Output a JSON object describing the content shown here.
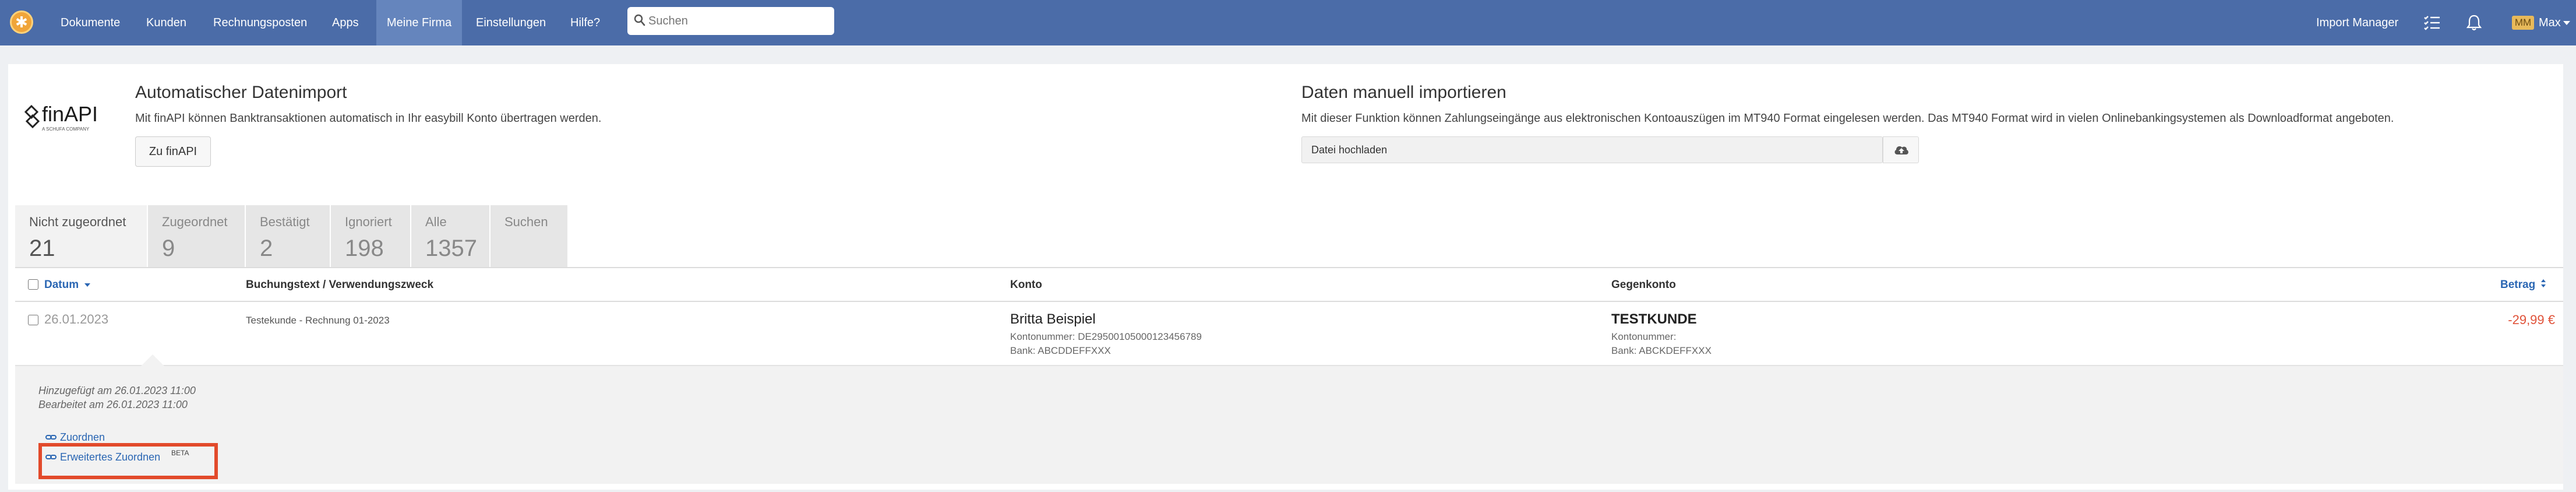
{
  "navbar": {
    "items": [
      {
        "label": "Dokumente"
      },
      {
        "label": "Kunden"
      },
      {
        "label": "Rechnungsposten"
      },
      {
        "label": "Apps"
      },
      {
        "label": "Meine Firma"
      },
      {
        "label": "Einstellungen"
      },
      {
        "label": "Hilfe?"
      }
    ],
    "active_item": "Meine Firma",
    "search_placeholder": "Suchen",
    "import_manager": "Import Manager",
    "avatar_initials": "MM",
    "user_name": "Max",
    "icons": [
      "logo-icon",
      "search-icon",
      "checklist-icon",
      "bell-icon",
      "caret-down-icon"
    ]
  },
  "auto_import": {
    "title": "Automatischer Datenimport",
    "description": "Mit finAPI können Banktransaktionen automatisch in Ihr easybill Konto übertragen werden.",
    "button": "Zu finAPI",
    "logo_text": "finAPI",
    "logo_sub": "A SCHUFA COMPANY"
  },
  "manual_import": {
    "title": "Daten manuell importieren",
    "description": "Mit dieser Funktion können Zahlungseingänge aus elektronischen Kontoauszügen im MT940 Format eingelesen werden. Das MT940 Format wird in vielen Onlinebankingsystemen als Downloadformat angeboten.",
    "upload_label": "Datei hochladen",
    "upload_icon": "cloud-upload-icon"
  },
  "tabs": [
    {
      "label": "Nicht zugeordnet",
      "count": "21"
    },
    {
      "label": "Zugeordnet",
      "count": "9"
    },
    {
      "label": "Bestätigt",
      "count": "2"
    },
    {
      "label": "Ignoriert",
      "count": "198"
    },
    {
      "label": "Alle",
      "count": "1357"
    },
    {
      "label": "Suchen",
      "count": ""
    }
  ],
  "active_tab": "Nicht zugeordnet",
  "table": {
    "headers": {
      "datum": "Datum",
      "buchungstext": "Buchungstext / Verwendungszweck",
      "konto": "Konto",
      "gegenkonto": "Gegenkonto",
      "betrag": "Betrag"
    },
    "rows": [
      {
        "datum": "26.01.2023",
        "buchungstext": "Testekunde - Rechnung 01-2023",
        "konto_name": "Britta Beispiel",
        "konto_nummer": "Kontonummer: DE29500105000123456789",
        "konto_bank": "Bank: ABCDDEFFXXX",
        "gegen_name": "TESTKUNDE",
        "gegen_nummer": "Kontonummer:",
        "gegen_bank": "Bank: ABCKDEFFXXX",
        "betrag": "-29,99 €"
      }
    ]
  },
  "detail": {
    "added": "Hinzugefügt am 26.01.2023 11:00",
    "edited": "Bearbeitet am 26.01.2023 11:00",
    "action_assign": "Zuordnen",
    "action_extended": "Erweitertes Zuordnen",
    "beta": "BETA"
  },
  "colors": {
    "navbar": "#4b6ca8",
    "navbar_active": "#6585bd",
    "link": "#2a66b3",
    "negative_amount": "#e0533a",
    "highlight_box": "#e24a2b"
  }
}
